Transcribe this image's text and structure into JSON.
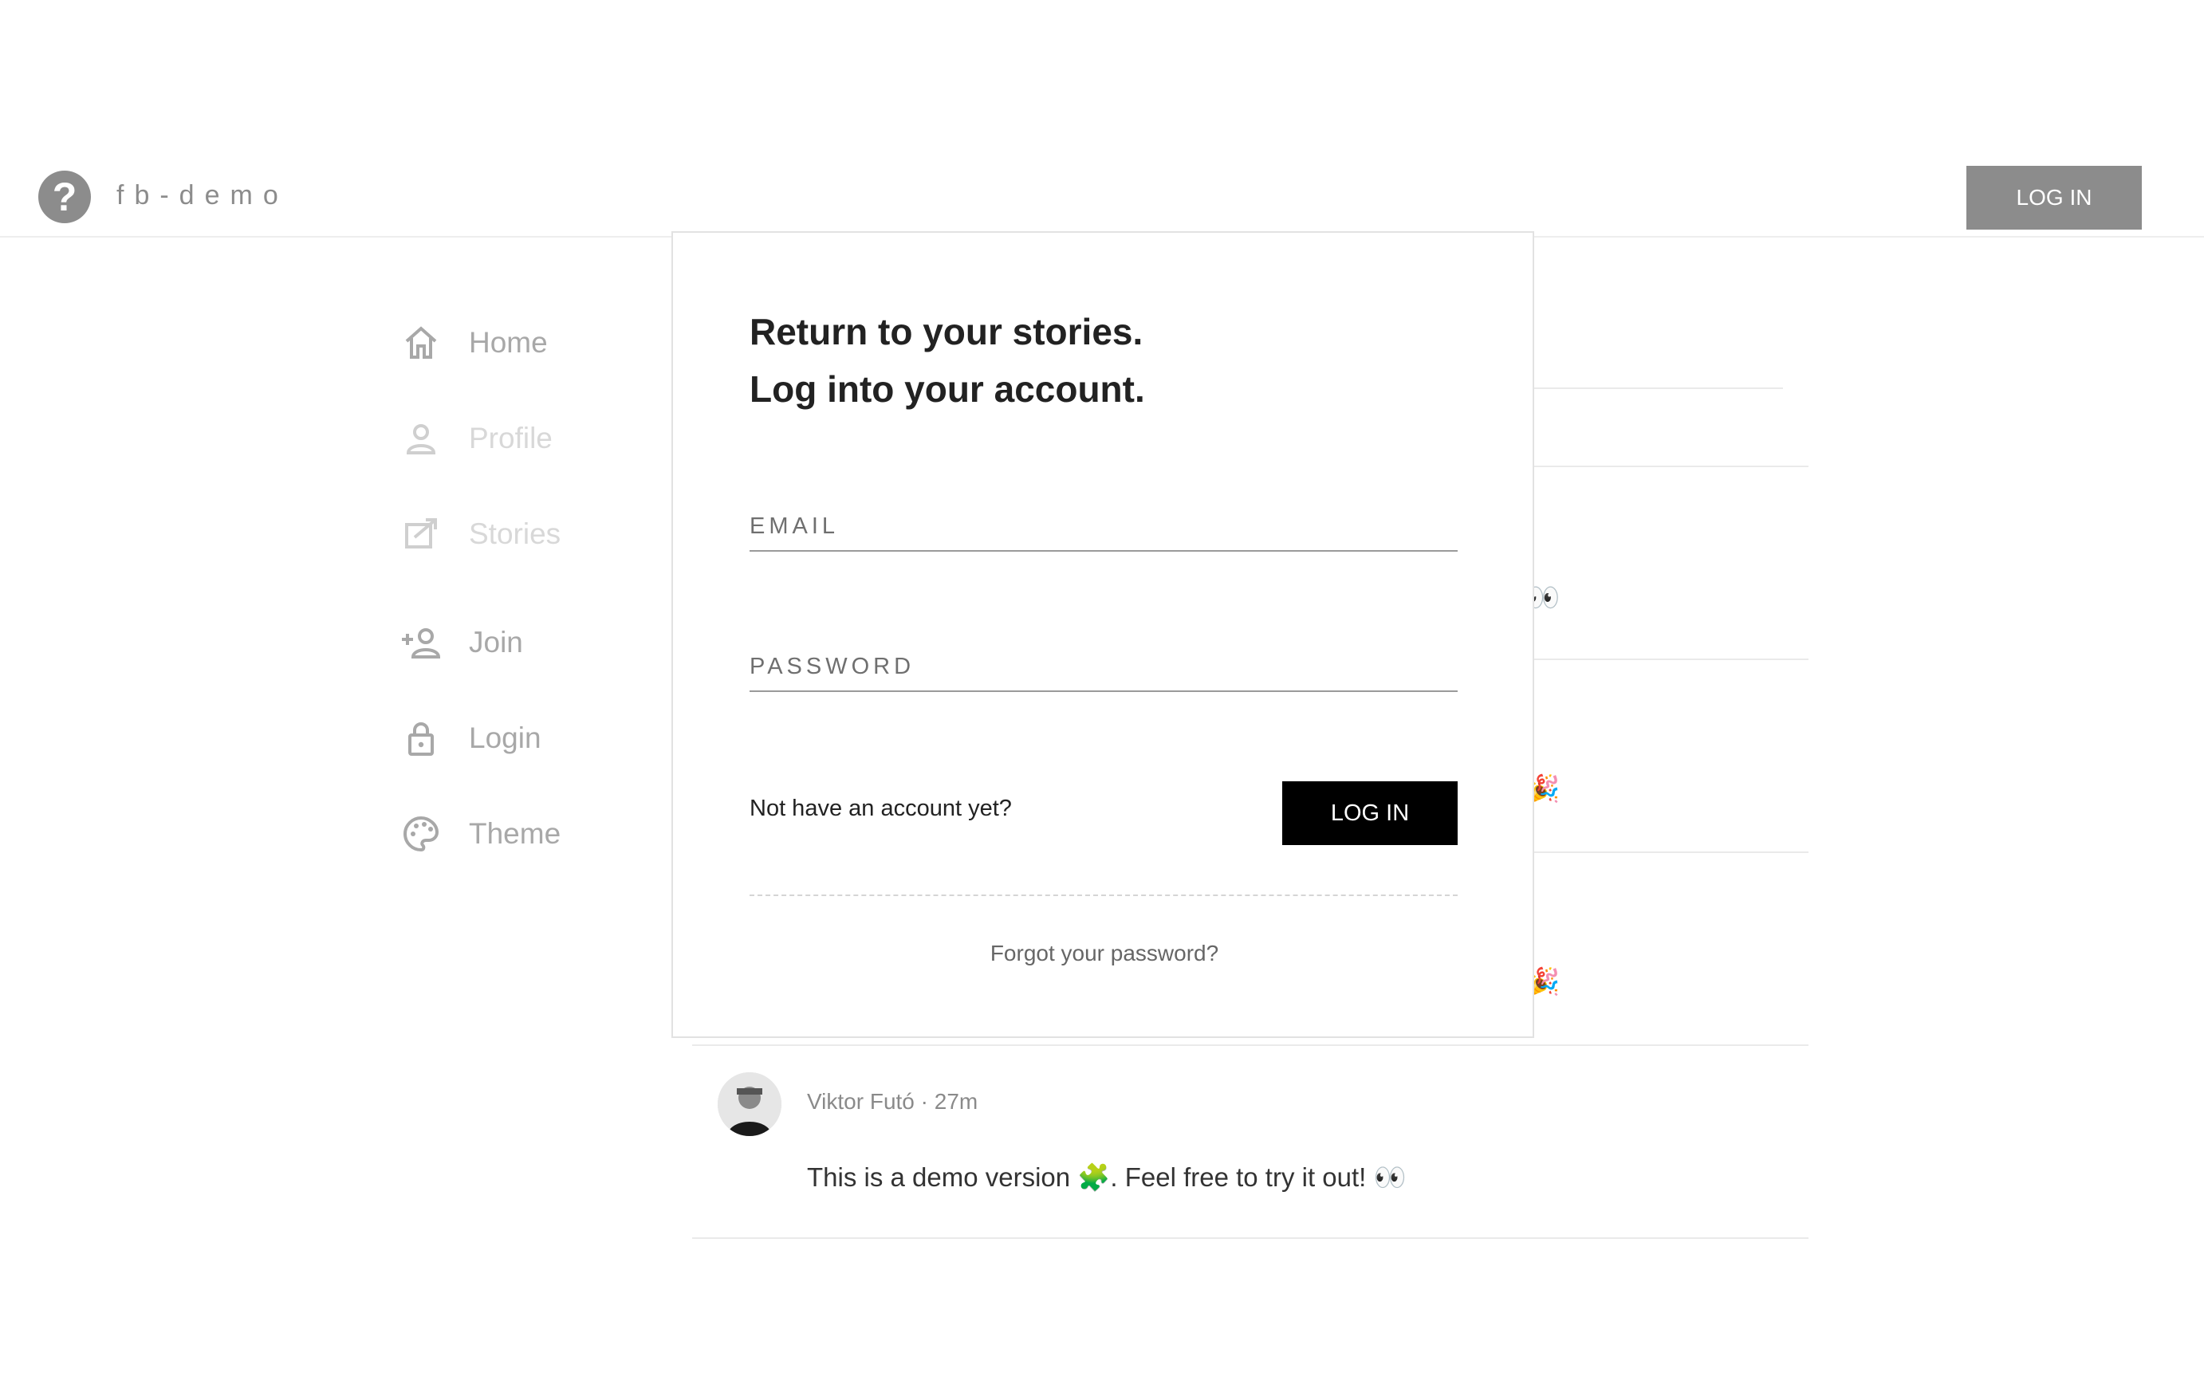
{
  "header": {
    "brand_name": "fb-demo",
    "brand_icon": "question-mark-icon",
    "login_label": "LOG IN"
  },
  "sidebar": {
    "items": [
      {
        "label": "Home",
        "icon": "home-icon"
      },
      {
        "label": "Profile",
        "icon": "person-icon"
      },
      {
        "label": "Stories",
        "icon": "stories-icon"
      },
      {
        "label": "Join",
        "icon": "person-add-icon"
      },
      {
        "label": "Login",
        "icon": "lock-icon"
      },
      {
        "label": "Theme",
        "icon": "palette-icon"
      }
    ]
  },
  "modal": {
    "title_line1": "Return to your stories.",
    "title_line2": "Log into your account.",
    "email_placeholder": "EMAIL",
    "password_placeholder": "PASSWORD",
    "signup_prompt": "Not have an account yet?",
    "login_label": "LOG IN",
    "forgot_label": "Forgot your password?"
  },
  "feed": {
    "posts": [
      {
        "author": "Viktor Futó",
        "time": "27m",
        "meta": "Viktor Futó · 27m",
        "body": "This is a demo version 🧩. Feel free to try it out! 👀"
      }
    ]
  },
  "colors": {
    "brand_gray": "#8c8c8c",
    "primary_button": "#000000",
    "border": "#e2e2e2"
  }
}
